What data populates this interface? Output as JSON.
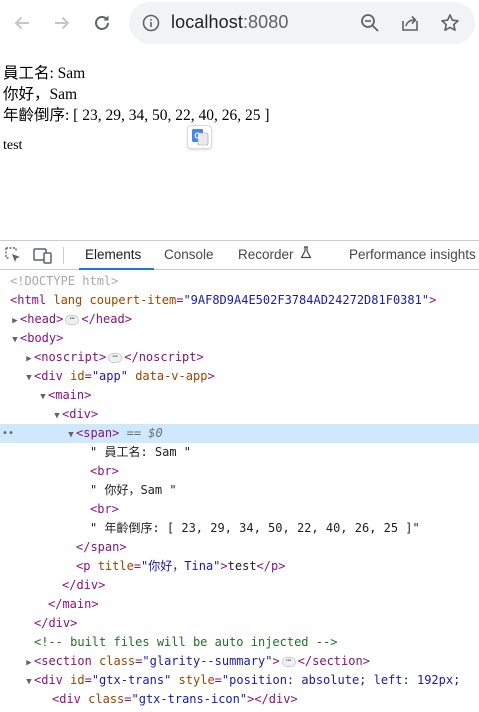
{
  "browser": {
    "url_host": "localhost",
    "url_port": ":8080",
    "icons": [
      "back-icon",
      "forward-icon",
      "reload-icon",
      "site-info-icon",
      "zoom-icon",
      "share-icon",
      "bookmark-star-icon"
    ]
  },
  "page": {
    "line1": "員工名: Sam",
    "line2": "你好，Sam",
    "line3": "年齡倒序: [ 23, 29, 34, 50, 22, 40, 26, 25 ]",
    "line4": "test"
  },
  "devtools": {
    "tabs": {
      "elements": "Elements",
      "console": "Console",
      "recorder": "Recorder",
      "performance": "Performance insights"
    },
    "dom": {
      "doctype": "<!DOCTYPE html>",
      "html_open": "<html",
      "html_lang_attr": "lang",
      "html_attr_name": "coupert-item",
      "html_attr_val": "\"9AF8D9A4E502F3784AD24272D81F0381\"",
      "head_open": "<head>",
      "head_close": "</head>",
      "body_open": "<body>",
      "noscript_open": "<noscript>",
      "noscript_close": "</noscript>",
      "div_app_open": "<div",
      "id_attr": "id",
      "app_id_val": "\"app\"",
      "data_v_app": "data-v-app",
      "main_open": "<main>",
      "div_open": "<div>",
      "span_open": "<span>",
      "selected_marker": "== $0",
      "text1": "\" 員工名: Sam \"",
      "br": "<br>",
      "text2": "\" 你好，Sam \"",
      "text3": "\" 年齡倒序: [ 23, 29, 34, 50, 22, 40, 26, 25 ]\"",
      "span_close": "</span>",
      "p_open": "<p",
      "title_attr": "title",
      "p_title_val": "\"你好，Tina\"",
      "p_text": "test",
      "p_close": "</p>",
      "div_close": "</div>",
      "main_close": "</main>",
      "comment": "<!-- built files will be auto injected -->",
      "section_open": "<section",
      "class_attr": "class",
      "section_class_val": "\"glarity--summary\"",
      "section_close": "</section>",
      "gtx_id_val": "\"gtx-trans\"",
      "style_attr": "style",
      "gtx_style_val": "\"position: absolute; left: 192px;",
      "div_class_open": "<div",
      "gtx_icon_class_val": "\"gtx-trans-icon\"",
      "gtx_icon_close": "</div>"
    }
  }
}
